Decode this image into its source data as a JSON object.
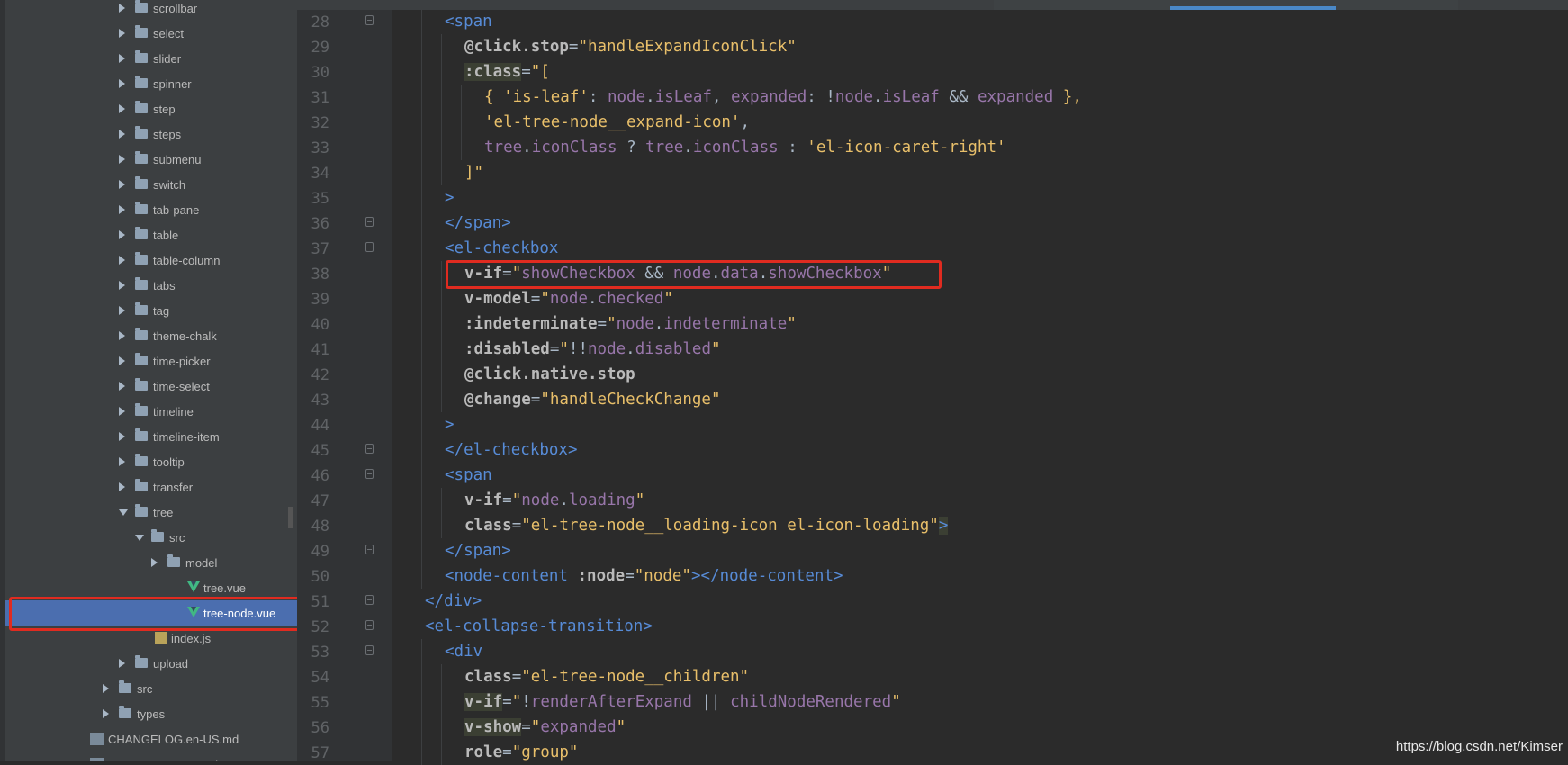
{
  "sidebar": {
    "items": [
      {
        "label": "scrollbar",
        "kind": "folder",
        "depth": 3,
        "open": false
      },
      {
        "label": "select",
        "kind": "folder",
        "depth": 3,
        "open": false
      },
      {
        "label": "slider",
        "kind": "folder",
        "depth": 3,
        "open": false
      },
      {
        "label": "spinner",
        "kind": "folder",
        "depth": 3,
        "open": false
      },
      {
        "label": "step",
        "kind": "folder",
        "depth": 3,
        "open": false
      },
      {
        "label": "steps",
        "kind": "folder",
        "depth": 3,
        "open": false
      },
      {
        "label": "submenu",
        "kind": "folder",
        "depth": 3,
        "open": false
      },
      {
        "label": "switch",
        "kind": "folder",
        "depth": 3,
        "open": false
      },
      {
        "label": "tab-pane",
        "kind": "folder",
        "depth": 3,
        "open": false
      },
      {
        "label": "table",
        "kind": "folder",
        "depth": 3,
        "open": false
      },
      {
        "label": "table-column",
        "kind": "folder",
        "depth": 3,
        "open": false
      },
      {
        "label": "tabs",
        "kind": "folder",
        "depth": 3,
        "open": false
      },
      {
        "label": "tag",
        "kind": "folder",
        "depth": 3,
        "open": false
      },
      {
        "label": "theme-chalk",
        "kind": "folder",
        "depth": 3,
        "open": false
      },
      {
        "label": "time-picker",
        "kind": "folder",
        "depth": 3,
        "open": false
      },
      {
        "label": "time-select",
        "kind": "folder",
        "depth": 3,
        "open": false
      },
      {
        "label": "timeline",
        "kind": "folder",
        "depth": 3,
        "open": false
      },
      {
        "label": "timeline-item",
        "kind": "folder",
        "depth": 3,
        "open": false
      },
      {
        "label": "tooltip",
        "kind": "folder",
        "depth": 3,
        "open": false
      },
      {
        "label": "transfer",
        "kind": "folder",
        "depth": 3,
        "open": false
      },
      {
        "label": "tree",
        "kind": "folder",
        "depth": 3,
        "open": true
      },
      {
        "label": "src",
        "kind": "folder",
        "depth": 4,
        "open": true
      },
      {
        "label": "model",
        "kind": "folder",
        "depth": 5,
        "open": false
      },
      {
        "label": "tree.vue",
        "kind": "vue",
        "depth": 5
      },
      {
        "label": "tree-node.vue",
        "kind": "vue",
        "depth": 5,
        "selected": true
      },
      {
        "label": "index.js",
        "kind": "js",
        "depth": 4
      },
      {
        "label": "upload",
        "kind": "folder",
        "depth": 3,
        "open": false
      },
      {
        "label": "src",
        "kind": "folder",
        "depth": 2,
        "open": false
      },
      {
        "label": "types",
        "kind": "folder",
        "depth": 2,
        "open": false
      },
      {
        "label": "CHANGELOG.en-US.md",
        "kind": "md",
        "depth": 1
      },
      {
        "label": "CHANGELOG.es.md",
        "kind": "md",
        "depth": 1
      }
    ]
  },
  "editor": {
    "lines": [
      {
        "n": "28",
        "indent": 2,
        "fold": true,
        "segs": [
          [
            "tag",
            "<span"
          ]
        ]
      },
      {
        "n": "29",
        "indent": 3,
        "fold": false,
        "segs": [
          [
            "directive",
            "@click.stop"
          ],
          [
            "plain",
            "="
          ],
          [
            "strval",
            "\"handleExpandIconClick\""
          ]
        ]
      },
      {
        "n": "30",
        "indent": 3,
        "fold": false,
        "segs": [
          [
            "directive hlbg",
            ":class"
          ],
          [
            "plain",
            "="
          ],
          [
            "strval",
            "\"["
          ]
        ]
      },
      {
        "n": "31",
        "indent": 4,
        "fold": false,
        "segs": [
          [
            "strval",
            "{ "
          ],
          [
            "sq",
            "'is-leaf'"
          ],
          [
            "plain",
            ": "
          ],
          [
            "ident",
            "node"
          ],
          [
            "plain",
            "."
          ],
          [
            "ident",
            "isLeaf"
          ],
          [
            "plain",
            ", "
          ],
          [
            "ident",
            "expanded"
          ],
          [
            "plain",
            ": !"
          ],
          [
            "ident",
            "node"
          ],
          [
            "plain",
            "."
          ],
          [
            "ident",
            "isLeaf"
          ],
          [
            "plain",
            " && "
          ],
          [
            "ident",
            "expanded"
          ],
          [
            "strval",
            " },"
          ]
        ]
      },
      {
        "n": "32",
        "indent": 4,
        "fold": false,
        "segs": [
          [
            "sq",
            "'el-tree-node__expand-icon'"
          ],
          [
            "plain",
            ","
          ]
        ]
      },
      {
        "n": "33",
        "indent": 4,
        "fold": false,
        "segs": [
          [
            "ident",
            "tree"
          ],
          [
            "plain",
            "."
          ],
          [
            "ident",
            "iconClass"
          ],
          [
            "plain",
            " ? "
          ],
          [
            "ident",
            "tree"
          ],
          [
            "plain",
            "."
          ],
          [
            "ident",
            "iconClass"
          ],
          [
            "plain",
            " : "
          ],
          [
            "sq",
            "'el-icon-caret-right'"
          ]
        ]
      },
      {
        "n": "34",
        "indent": 3,
        "fold": false,
        "segs": [
          [
            "strval",
            "]\""
          ]
        ]
      },
      {
        "n": "35",
        "indent": 2,
        "fold": false,
        "segs": [
          [
            "tag",
            ">"
          ]
        ]
      },
      {
        "n": "36",
        "indent": 2,
        "fold": true,
        "segs": [
          [
            "tag",
            "</span>"
          ]
        ]
      },
      {
        "n": "37",
        "indent": 2,
        "fold": true,
        "segs": [
          [
            "tag",
            "<el-checkbox"
          ]
        ]
      },
      {
        "n": "38",
        "indent": 3,
        "fold": false,
        "segs": [
          [
            "directive",
            "v-if"
          ],
          [
            "plain",
            "="
          ],
          [
            "strval",
            "\""
          ],
          [
            "ident",
            "showCheckbox"
          ],
          [
            "plain",
            " && "
          ],
          [
            "ident",
            "node"
          ],
          [
            "plain",
            "."
          ],
          [
            "ident",
            "data"
          ],
          [
            "plain",
            "."
          ],
          [
            "ident",
            "showCheckbox"
          ],
          [
            "strval",
            "\""
          ]
        ]
      },
      {
        "n": "39",
        "indent": 3,
        "fold": false,
        "segs": [
          [
            "directive",
            "v-model"
          ],
          [
            "plain",
            "="
          ],
          [
            "strval",
            "\""
          ],
          [
            "ident",
            "node"
          ],
          [
            "plain",
            "."
          ],
          [
            "ident",
            "checked"
          ],
          [
            "strval",
            "\""
          ]
        ]
      },
      {
        "n": "40",
        "indent": 3,
        "fold": false,
        "segs": [
          [
            "directive",
            ":indeterminate"
          ],
          [
            "plain",
            "="
          ],
          [
            "strval",
            "\""
          ],
          [
            "ident",
            "node"
          ],
          [
            "plain",
            "."
          ],
          [
            "ident",
            "indeterminate"
          ],
          [
            "strval",
            "\""
          ]
        ]
      },
      {
        "n": "41",
        "indent": 3,
        "fold": false,
        "segs": [
          [
            "directive",
            ":disabled"
          ],
          [
            "plain",
            "="
          ],
          [
            "strval",
            "\""
          ],
          [
            "plain",
            "!!"
          ],
          [
            "ident",
            "node"
          ],
          [
            "plain",
            "."
          ],
          [
            "ident",
            "disabled"
          ],
          [
            "strval",
            "\""
          ]
        ]
      },
      {
        "n": "42",
        "indent": 3,
        "fold": false,
        "segs": [
          [
            "directive",
            "@click.native.stop"
          ]
        ]
      },
      {
        "n": "43",
        "indent": 3,
        "fold": false,
        "segs": [
          [
            "directive",
            "@change"
          ],
          [
            "plain",
            "="
          ],
          [
            "strval",
            "\"handleCheckChange\""
          ]
        ]
      },
      {
        "n": "44",
        "indent": 2,
        "fold": false,
        "segs": [
          [
            "tag",
            ">"
          ]
        ]
      },
      {
        "n": "45",
        "indent": 2,
        "fold": true,
        "segs": [
          [
            "tag",
            "</el-checkbox>"
          ]
        ]
      },
      {
        "n": "46",
        "indent": 2,
        "fold": true,
        "segs": [
          [
            "tag",
            "<span"
          ]
        ]
      },
      {
        "n": "47",
        "indent": 3,
        "fold": false,
        "segs": [
          [
            "directive",
            "v-if"
          ],
          [
            "plain",
            "="
          ],
          [
            "strval",
            "\""
          ],
          [
            "ident",
            "node"
          ],
          [
            "plain",
            "."
          ],
          [
            "ident",
            "loading"
          ],
          [
            "strval",
            "\""
          ]
        ]
      },
      {
        "n": "48",
        "indent": 3,
        "fold": false,
        "segs": [
          [
            "directive",
            "class"
          ],
          [
            "plain",
            "="
          ],
          [
            "strval",
            "\"el-tree-node__loading-icon el-icon-loading\""
          ],
          [
            "tag hlbg",
            ">"
          ]
        ]
      },
      {
        "n": "49",
        "indent": 2,
        "fold": true,
        "segs": [
          [
            "tag",
            "</span>"
          ]
        ]
      },
      {
        "n": "50",
        "indent": 2,
        "fold": false,
        "segs": [
          [
            "tag",
            "<node-content "
          ],
          [
            "directive",
            ":node"
          ],
          [
            "plain",
            "="
          ],
          [
            "strval",
            "\"node\""
          ],
          [
            "tag",
            "></node-content>"
          ]
        ]
      },
      {
        "n": "51",
        "indent": 1,
        "fold": true,
        "segs": [
          [
            "tag",
            "</div>"
          ]
        ]
      },
      {
        "n": "52",
        "indent": 1,
        "fold": true,
        "segs": [
          [
            "tag",
            "<el-collapse-transition>"
          ]
        ]
      },
      {
        "n": "53",
        "indent": 2,
        "fold": true,
        "segs": [
          [
            "tag",
            "<div"
          ]
        ]
      },
      {
        "n": "54",
        "indent": 3,
        "fold": false,
        "segs": [
          [
            "directive",
            "class"
          ],
          [
            "plain",
            "="
          ],
          [
            "strval",
            "\"el-tree-node__children\""
          ]
        ]
      },
      {
        "n": "55",
        "indent": 3,
        "fold": false,
        "segs": [
          [
            "directive hlbg",
            "v-if"
          ],
          [
            "plain",
            "="
          ],
          [
            "strval",
            "\""
          ],
          [
            "plain",
            "!"
          ],
          [
            "ident",
            "renderAfterExpand"
          ],
          [
            "plain",
            " || "
          ],
          [
            "ident",
            "childNodeRendered"
          ],
          [
            "strval",
            "\""
          ]
        ]
      },
      {
        "n": "56",
        "indent": 3,
        "fold": false,
        "segs": [
          [
            "directive hlbg",
            "v-show"
          ],
          [
            "plain",
            "="
          ],
          [
            "strval",
            "\""
          ],
          [
            "ident",
            "expanded"
          ],
          [
            "strval",
            "\""
          ]
        ]
      },
      {
        "n": "57",
        "indent": 3,
        "fold": false,
        "segs": [
          [
            "directive",
            "role"
          ],
          [
            "plain",
            "="
          ],
          [
            "strval",
            "\"group\""
          ]
        ]
      }
    ]
  },
  "watermark": "https://blog.csdn.net/Kimser"
}
